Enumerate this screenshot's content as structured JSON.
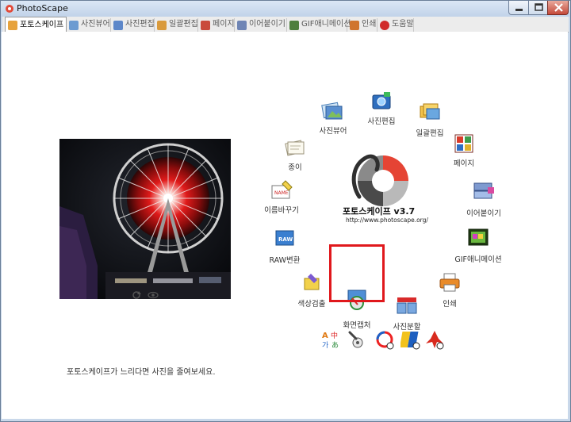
{
  "window": {
    "title": "PhotoScape"
  },
  "tabs": [
    {
      "label": "포토스케이프",
      "color": "#e7a33d"
    },
    {
      "label": "사진뷰어",
      "color": "#6c9bd1"
    },
    {
      "label": "사진편집",
      "color": "#5d87c9"
    },
    {
      "label": "일괄편집",
      "color": "#d99a3c"
    },
    {
      "label": "페이지",
      "color": "#c94b3c"
    },
    {
      "label": "이어붙이기",
      "color": "#6f85b5"
    },
    {
      "label": "GIF애니메이션",
      "color": "#4e7f3e"
    },
    {
      "label": "인쇄",
      "color": "#d0752f"
    },
    {
      "label": "도움말",
      "color": "#d02b2b"
    }
  ],
  "home": {
    "items": {
      "viewer": "사진뷰어",
      "editor": "사진편집",
      "batch": "일괄편집",
      "paper": "종이",
      "page": "페이지",
      "rename": "이름바꾸기",
      "combine": "이어붙이기",
      "raw": "RAW변환",
      "gif": "GIF애니메이션",
      "color_picker": "색상검출",
      "print": "인쇄",
      "screen_capture": "화면캡처",
      "splitter": "사진분할"
    },
    "logo_title": "포토스케이프 v3.7",
    "logo_url": "http://www.photoscape.org/",
    "hint": "포토스케이프가 느리다면 사진을 줄여보세요.",
    "accent": "#e0181c"
  }
}
